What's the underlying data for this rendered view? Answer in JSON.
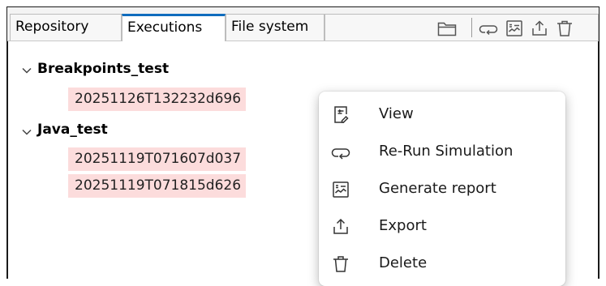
{
  "tabs": [
    {
      "label": "Repository",
      "active": false
    },
    {
      "label": "Executions",
      "active": true
    },
    {
      "label": "File system",
      "active": false
    }
  ],
  "toolbar": {
    "icons": [
      "folder-icon",
      "rerun-icon",
      "report-icon",
      "export-icon",
      "delete-icon"
    ]
  },
  "tree": {
    "groups": [
      {
        "name": "Breakpoints_test",
        "expanded": true,
        "executions": [
          "20251126T132232d696"
        ]
      },
      {
        "name": "Java_test",
        "expanded": true,
        "executions": [
          "20251119T071607d037",
          "20251119T071815d626"
        ]
      }
    ]
  },
  "context_menu": {
    "items": [
      {
        "label": "View",
        "icon": "view-icon"
      },
      {
        "label": "Re-Run Simulation",
        "icon": "rerun-icon"
      },
      {
        "label": "Generate report",
        "icon": "report-icon"
      },
      {
        "label": "Export",
        "icon": "export-icon"
      },
      {
        "label": "Delete",
        "icon": "delete-icon"
      }
    ]
  },
  "colors": {
    "active_tab_accent": "#0f6cbd",
    "execution_highlight": "#fcdcdc"
  }
}
